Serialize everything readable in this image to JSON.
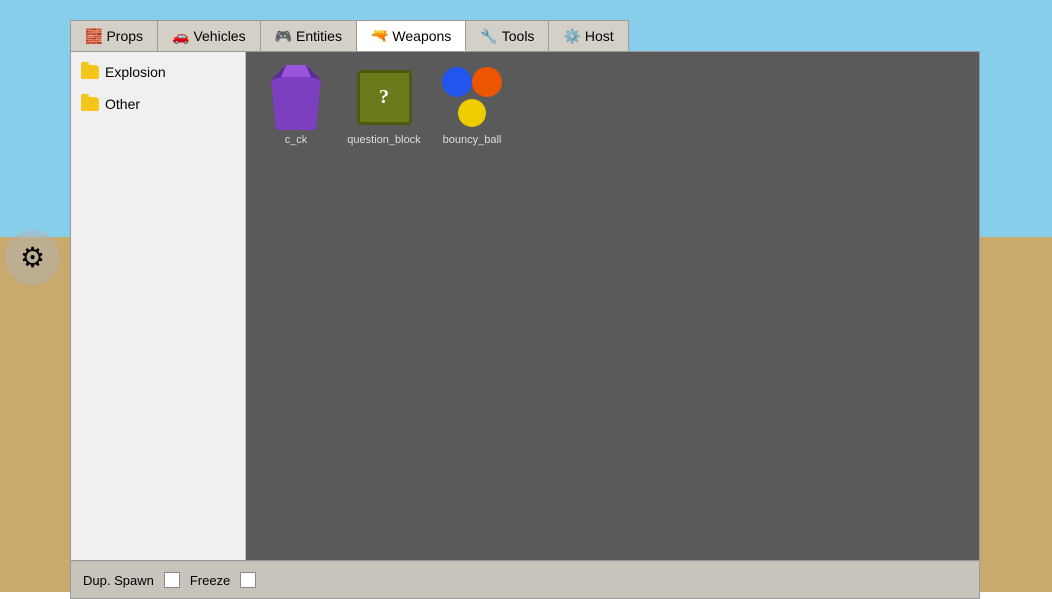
{
  "background": {
    "sky_color": "#87CEEB",
    "ground_color": "#C8A96E"
  },
  "tabs": [
    {
      "id": "props",
      "label": "Props",
      "icon": "🧱",
      "active": false
    },
    {
      "id": "vehicles",
      "label": "Vehicles",
      "icon": "🚗",
      "active": false
    },
    {
      "id": "entities",
      "label": "Entities",
      "icon": "🎮",
      "active": false
    },
    {
      "id": "weapons",
      "label": "Weapons",
      "icon": "🔫",
      "active": true
    },
    {
      "id": "tools",
      "label": "Tools",
      "icon": "🔧",
      "active": false
    },
    {
      "id": "host",
      "label": "Host",
      "icon": "⚙️",
      "active": false
    }
  ],
  "sidebar": {
    "items": [
      {
        "id": "explosion",
        "label": "Explosion"
      },
      {
        "id": "other",
        "label": "Other"
      }
    ]
  },
  "items": [
    {
      "id": "c_ck",
      "label": "c_ck",
      "type": "cck"
    },
    {
      "id": "question_block",
      "label": "question_block",
      "type": "qblock"
    },
    {
      "id": "bouncy_ball",
      "label": "bouncy_ball",
      "type": "ball"
    }
  ],
  "bottom_bar": {
    "dup_spawn_label": "Dup. Spawn",
    "freeze_label": "Freeze"
  }
}
